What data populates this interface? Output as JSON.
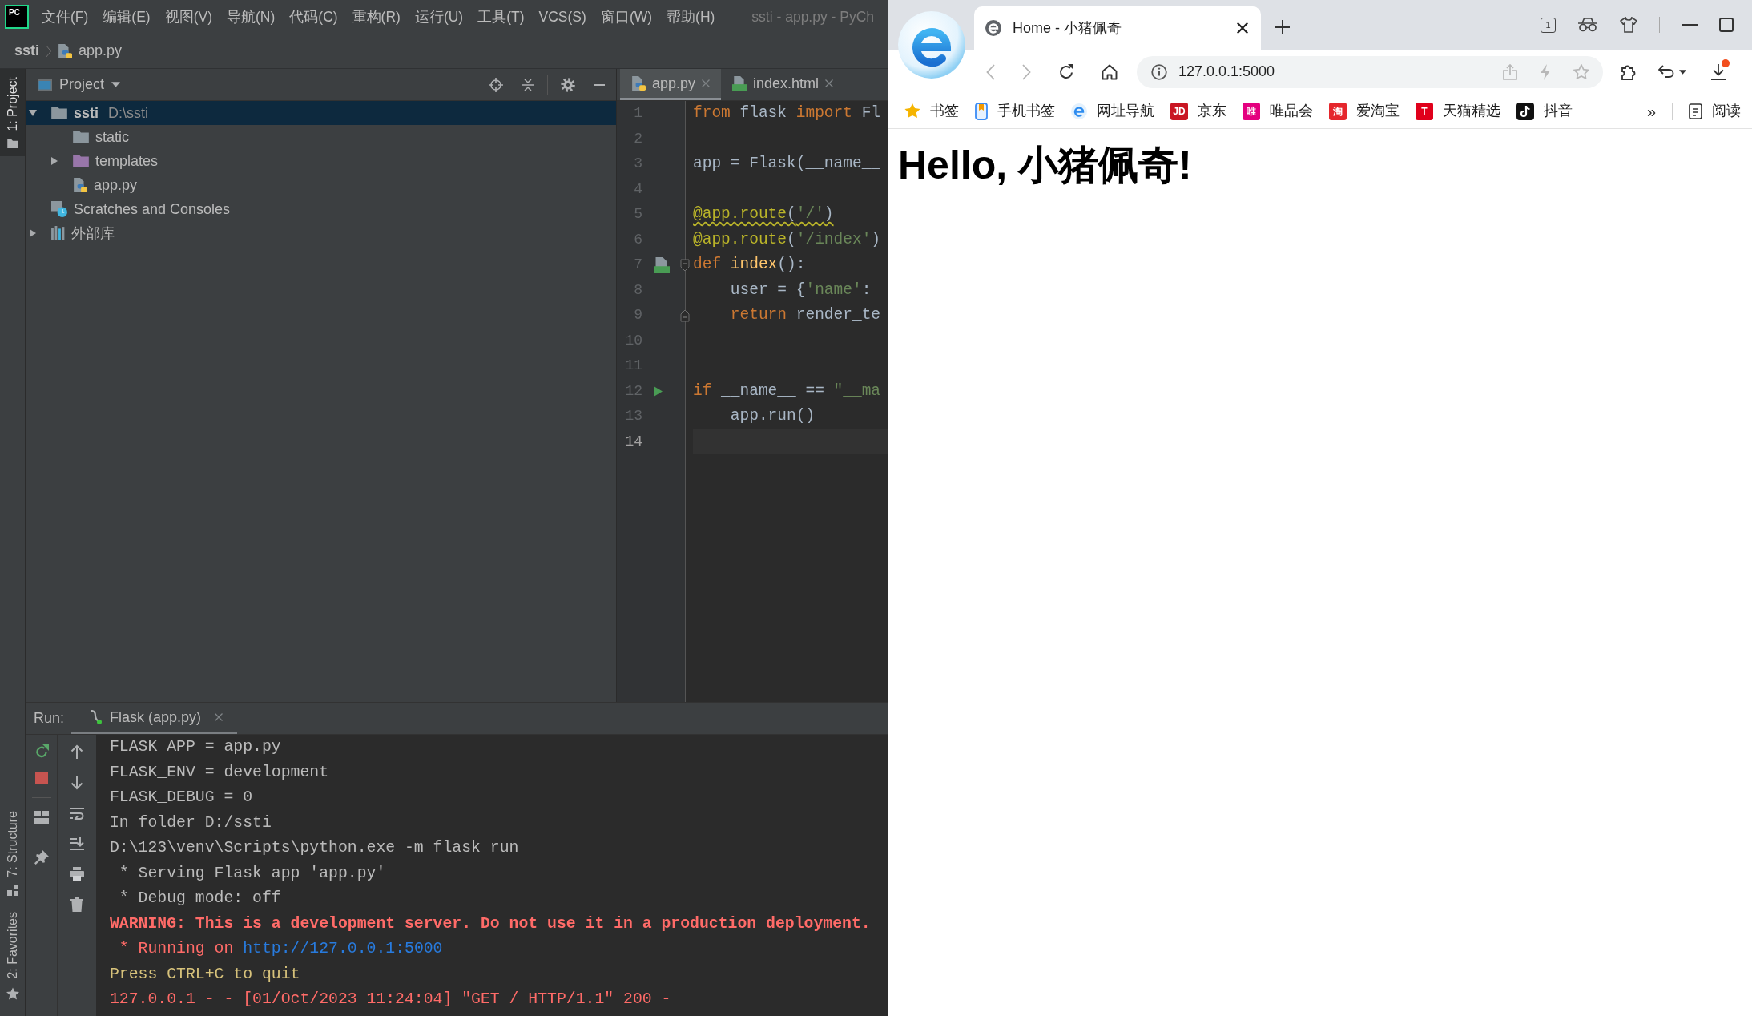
{
  "ide": {
    "logo": "PC",
    "menu": [
      "文件(F)",
      "编辑(E)",
      "视图(V)",
      "导航(N)",
      "代码(C)",
      "重构(R)",
      "运行(U)",
      "工具(T)",
      "VCS(S)",
      "窗口(W)",
      "帮助(H)"
    ],
    "title": "ssti - app.py - PyCh",
    "breadcrumbs": [
      {
        "label": "ssti",
        "kind": "project"
      },
      {
        "label": "app.py",
        "kind": "python"
      }
    ],
    "side_tabs": [
      {
        "label": "1: Project",
        "kind": "project",
        "selected": true
      },
      {
        "label": "7: Structure",
        "kind": "structure",
        "selected": false
      },
      {
        "label": "2: Favorites",
        "kind": "favorites",
        "selected": false
      }
    ],
    "project_panel": {
      "title": "Project",
      "tree": [
        {
          "label": "ssti",
          "path": "D:\\ssti",
          "kind": "project",
          "expanded": true,
          "selected": true,
          "children": [
            {
              "label": "static",
              "kind": "folder",
              "selected": false
            },
            {
              "label": "templates",
              "kind": "template_folder",
              "expanded": false,
              "selected": false
            },
            {
              "label": "app.py",
              "kind": "python",
              "selected": false
            }
          ]
        },
        {
          "label": "Scratches and Consoles",
          "kind": "scratches",
          "selected": false
        },
        {
          "label": "外部库",
          "kind": "library",
          "expanded": false,
          "selected": false
        }
      ]
    },
    "editor": {
      "tabs": [
        {
          "label": "app.py",
          "kind": "python",
          "selected": true
        },
        {
          "label": "index.html",
          "kind": "html",
          "selected": false
        }
      ],
      "lines": [
        {
          "number": "1",
          "current": false,
          "warning": false,
          "tokens": [
            {
              "text": "from",
              "kind": "keyword"
            },
            {
              "text": " flask ",
              "kind": "plain"
            },
            {
              "text": "import",
              "kind": "keyword"
            },
            {
              "text": " Fl",
              "kind": "plain"
            }
          ]
        },
        {
          "number": "2",
          "current": false
        },
        {
          "number": "3",
          "current": false,
          "warning": false,
          "tokens": [
            {
              "text": "app = Flask(__name__",
              "kind": "plain"
            }
          ]
        },
        {
          "number": "4",
          "current": false
        },
        {
          "number": "5",
          "current": false,
          "warning": true,
          "tokens": [
            {
              "text": "@app.route",
              "kind": "decorator"
            },
            {
              "text": "(",
              "kind": "plain"
            },
            {
              "text": "'/'",
              "kind": "string"
            },
            {
              "text": ")",
              "kind": "plain"
            }
          ]
        },
        {
          "number": "6",
          "current": false,
          "warning": false,
          "tokens": [
            {
              "text": "@app.route",
              "kind": "decorator"
            },
            {
              "text": "(",
              "kind": "plain"
            },
            {
              "text": "'/index'",
              "kind": "string"
            },
            {
              "text": ")",
              "kind": "plain"
            }
          ]
        },
        {
          "number": "7",
          "current": false,
          "warning": false,
          "gutter_icon": {
            "kind": "html"
          },
          "fold": {
            "kind": "start"
          },
          "tokens": [
            {
              "text": "def",
              "kind": "keyword"
            },
            {
              "text": " index",
              "kind": "function"
            },
            {
              "text": "():",
              "kind": "plain"
            }
          ]
        },
        {
          "number": "8",
          "current": false,
          "warning": false,
          "tokens": [
            {
              "text": "    user = {",
              "kind": "plain"
            },
            {
              "text": "'name'",
              "kind": "string"
            },
            {
              "text": ":",
              "kind": "plain"
            }
          ]
        },
        {
          "number": "9",
          "current": false,
          "warning": false,
          "fold": {
            "kind": "end"
          },
          "tokens": [
            {
              "text": "    return",
              "kind": "keyword"
            },
            {
              "text": " render_te",
              "kind": "plain"
            }
          ]
        },
        {
          "number": "10",
          "current": false
        },
        {
          "number": "11",
          "current": false
        },
        {
          "number": "12",
          "current": false,
          "warning": false,
          "gutter_icon": {
            "kind": "run"
          },
          "tokens": [
            {
              "text": "if",
              "kind": "keyword"
            },
            {
              "text": " __name__ == ",
              "kind": "plain"
            },
            {
              "text": "\"__ma",
              "kind": "string"
            }
          ]
        },
        {
          "number": "13",
          "current": false,
          "warning": false,
          "tokens": [
            {
              "text": "    app.run()",
              "kind": "plain"
            }
          ]
        },
        {
          "number": "14",
          "current": true
        }
      ]
    },
    "run_panel": {
      "label": "Run:",
      "tab": "Flask (app.py)",
      "lines": [
        {
          "text": "FLASK_APP = app.py",
          "kind": "output"
        },
        {
          "text": "FLASK_ENV = development",
          "kind": "output"
        },
        {
          "text": "FLASK_DEBUG = 0",
          "kind": "output"
        },
        {
          "text": "In folder D:/ssti",
          "kind": "output"
        },
        {
          "text": "D:\\123\\venv\\Scripts\\python.exe -m flask run",
          "kind": "output"
        },
        {
          "text": " * Serving Flask app 'app.py'",
          "kind": "output"
        },
        {
          "text": " * Debug mode: off",
          "kind": "output"
        },
        {
          "text": "WARNING: This is a development server. Do not use it in a production deployment.",
          "kind": "warning"
        },
        {
          "text": " * Running on ",
          "kind": "error",
          "link": "http://127.0.0.1:5000"
        },
        {
          "text": "Press CTRL+C to quit",
          "kind": "notice"
        },
        {
          "text": "127.0.0.1 - - [01/Oct/2023 11:24:04] \"GET / HTTP/1.1\" 200 -",
          "kind": "error"
        }
      ]
    }
  },
  "browser": {
    "tabs": [
      {
        "title": "Home - 小猪佩奇",
        "selected": true
      }
    ],
    "tab_count": "1",
    "nav": [
      {
        "kind": "back",
        "disabled": true
      },
      {
        "kind": "forward",
        "disabled": true
      },
      {
        "kind": "reload",
        "disabled": false
      },
      {
        "kind": "home",
        "disabled": false
      }
    ],
    "address": "127.0.0.1:5000",
    "bookmarks": [
      {
        "label": "书签",
        "kind": "star"
      },
      {
        "label": "手机书签",
        "kind": "phone"
      },
      {
        "label": "网址导航",
        "kind": "edge"
      },
      {
        "label": "京东",
        "kind": "letter",
        "logo": "JD",
        "color": "#c91623"
      },
      {
        "label": "唯品会",
        "kind": "letter",
        "logo": "唯",
        "color": "#e4007f"
      },
      {
        "label": "爱淘宝",
        "kind": "letter",
        "logo": "淘",
        "color": "#e5262c"
      },
      {
        "label": "天猫精选",
        "kind": "letter",
        "logo": "T",
        "color": "#e0001b"
      },
      {
        "label": "抖音",
        "kind": "tiktok"
      }
    ],
    "overflow": "»",
    "reader": "阅读",
    "page": {
      "heading": "Hello, 小猪佩奇!"
    }
  }
}
